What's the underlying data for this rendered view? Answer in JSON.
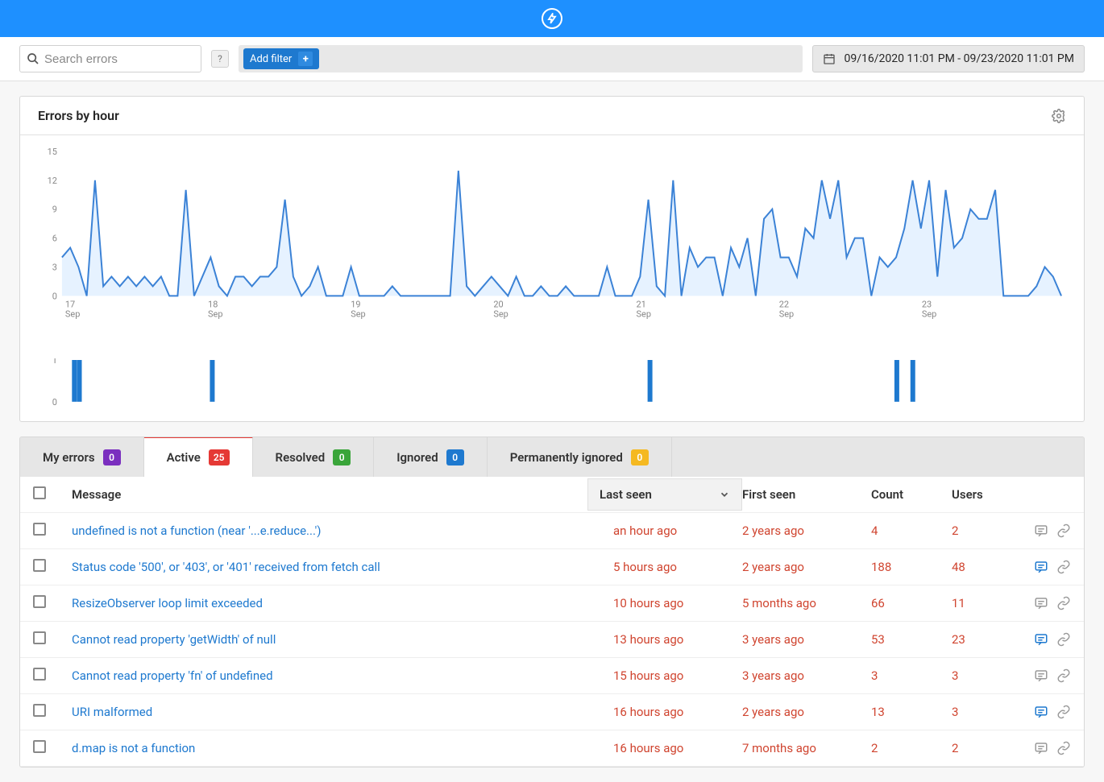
{
  "search": {
    "placeholder": "Search errors"
  },
  "filterbar": {
    "add_label": "Add filter"
  },
  "daterange": {
    "text": "09/16/2020 11:01 PM - 09/23/2020 11:01 PM"
  },
  "panel": {
    "title": "Errors by hour"
  },
  "chart_data": {
    "type": "area",
    "title": "Errors by hour",
    "xlabel": "",
    "ylabel": "",
    "ylim": [
      0,
      15
    ],
    "yticks": [
      0,
      3,
      6,
      9,
      12,
      15
    ],
    "x_ticks": [
      {
        "major": "17",
        "minor": "Sep"
      },
      {
        "major": "18",
        "minor": "Sep"
      },
      {
        "major": "19",
        "minor": "Sep"
      },
      {
        "major": "20",
        "minor": "Sep"
      },
      {
        "major": "21",
        "minor": "Sep"
      },
      {
        "major": "22",
        "minor": "Sep"
      },
      {
        "major": "23",
        "minor": "Sep"
      }
    ],
    "values": [
      4,
      5,
      3,
      0,
      12,
      1,
      2,
      1,
      2,
      1,
      2,
      1,
      2,
      0,
      0,
      11,
      0,
      2,
      4,
      1,
      0,
      2,
      2,
      1,
      2,
      2,
      3,
      10,
      2,
      0,
      1,
      3,
      0,
      0,
      0,
      3,
      0,
      0,
      0,
      0,
      1,
      0,
      0,
      0,
      0,
      0,
      0,
      0,
      13,
      1,
      0,
      1,
      2,
      1,
      0,
      2,
      0,
      0,
      1,
      0,
      0,
      1,
      0,
      0,
      0,
      0,
      3,
      0,
      0,
      0,
      2,
      10,
      1,
      0,
      12,
      0,
      5,
      3,
      4,
      4,
      0,
      5,
      3,
      6,
      0,
      8,
      9,
      4,
      4,
      2,
      7,
      6,
      12,
      8,
      12,
      4,
      6,
      6,
      0,
      4,
      3,
      4,
      7,
      12,
      7,
      12,
      2,
      11,
      5,
      6,
      9,
      8,
      8,
      11,
      0,
      0,
      0,
      0,
      1,
      3,
      2,
      0
    ]
  },
  "secondary_chart": {
    "type": "bar",
    "ylim": [
      0,
      1
    ],
    "yticks": [
      0,
      1
    ],
    "bars": [
      {
        "x": 0.01,
        "h": 1
      },
      {
        "x": 0.015,
        "h": 1
      },
      {
        "x": 0.148,
        "h": 1
      },
      {
        "x": 0.586,
        "h": 1
      },
      {
        "x": 0.833,
        "h": 1
      },
      {
        "x": 0.849,
        "h": 1
      }
    ]
  },
  "tabs": [
    {
      "label": "My errors",
      "count": "0",
      "badge": "purple",
      "id": "myerrors"
    },
    {
      "label": "Active",
      "count": "25",
      "badge": "red",
      "id": "active",
      "active": true
    },
    {
      "label": "Resolved",
      "count": "0",
      "badge": "green",
      "id": "resolved"
    },
    {
      "label": "Ignored",
      "count": "0",
      "badge": "blue",
      "id": "ignored"
    },
    {
      "label": "Permanently ignored",
      "count": "0",
      "badge": "yellow",
      "id": "permignored"
    }
  ],
  "table": {
    "headers": {
      "message": "Message",
      "last_seen": "Last seen",
      "first_seen": "First seen",
      "count": "Count",
      "users": "Users"
    },
    "rows": [
      {
        "message": "undefined is not a function (near '...e.reduce...')",
        "last": "an hour ago",
        "first": "2 years ago",
        "count": "4",
        "users": "2",
        "comment_active": false
      },
      {
        "message": "Status code '500', or '403', or '401' received from fetch call",
        "last": "5 hours ago",
        "first": "2 years ago",
        "count": "188",
        "users": "48",
        "comment_active": true
      },
      {
        "message": "ResizeObserver loop limit exceeded",
        "last": "10 hours ago",
        "first": "5 months ago",
        "count": "66",
        "users": "11",
        "comment_active": false
      },
      {
        "message": "Cannot read property 'getWidth' of null",
        "last": "13 hours ago",
        "first": "3 years ago",
        "count": "53",
        "users": "23",
        "comment_active": true
      },
      {
        "message": "Cannot read property 'fn' of undefined",
        "last": "15 hours ago",
        "first": "3 years ago",
        "count": "3",
        "users": "3",
        "comment_active": false
      },
      {
        "message": "URI malformed",
        "last": "16 hours ago",
        "first": "2 years ago",
        "count": "13",
        "users": "3",
        "comment_active": true
      },
      {
        "message": "d.map is not a function",
        "last": "16 hours ago",
        "first": "7 months ago",
        "count": "2",
        "users": "2",
        "comment_active": false
      }
    ]
  }
}
